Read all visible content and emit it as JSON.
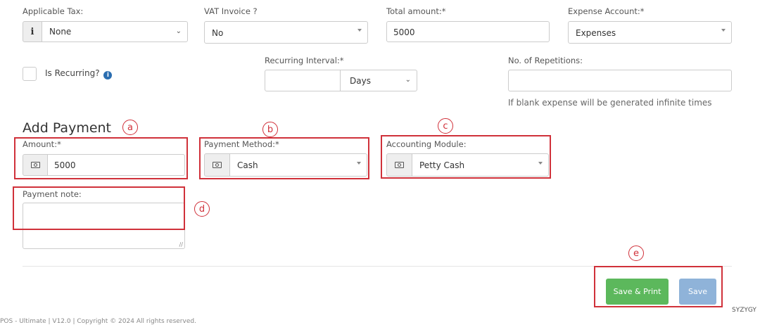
{
  "tax": {
    "label": "Applicable Tax:",
    "value": "None",
    "icon": "info-icon"
  },
  "vat": {
    "label": "VAT Invoice ?",
    "value": "No"
  },
  "total": {
    "label": "Total amount:*",
    "value": "5000"
  },
  "expense_account": {
    "label": "Expense Account:*",
    "value": "Expenses"
  },
  "recurring": {
    "checkbox_label": "Is Recurring?",
    "interval_label": "Recurring Interval:*",
    "interval_value": "",
    "interval_unit": "Days"
  },
  "repetitions": {
    "label": "No. of Repetitions:",
    "value": "",
    "help": "If blank expense will be generated infinite times"
  },
  "payment": {
    "heading": "Add Payment",
    "amount_label": "Amount:*",
    "amount_value": "5000",
    "method_label": "Payment Method:*",
    "method_value": "Cash",
    "module_label": "Accounting Module:",
    "module_value": "Petty Cash",
    "note_label": "Payment note:",
    "note_value": ""
  },
  "buttons": {
    "save_print": "Save & Print",
    "save": "Save"
  },
  "annotations": {
    "a": "a",
    "b": "b",
    "c": "c",
    "d": "d",
    "e": "e"
  },
  "brand": "SYZYGY",
  "footer": "POS - Ultimate | V12.0 | Copyright © 2024 All rights reserved.",
  "colors": {
    "annotation": "#d0313a",
    "save_print_button": "#5cb85c",
    "save_button": "#8fb3d9"
  }
}
